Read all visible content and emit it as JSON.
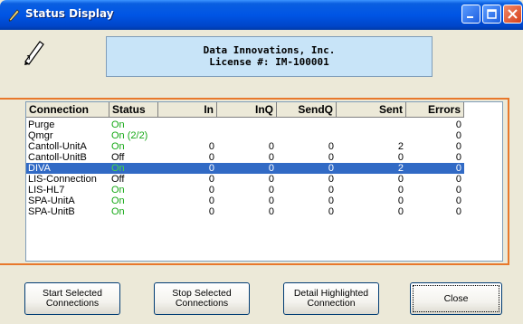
{
  "window": {
    "title": "Status Display"
  },
  "license": {
    "line1": "Data Innovations, Inc.",
    "line2": "License #: IM-100001"
  },
  "table": {
    "columns": [
      "Connection",
      "Status",
      "In",
      "InQ",
      "SendQ",
      "Sent",
      "Errors"
    ],
    "rows": [
      {
        "connection": "Purge",
        "status": "On",
        "in": "",
        "inq": "",
        "sendq": "",
        "sent": "",
        "errors": "0"
      },
      {
        "connection": "Qmgr",
        "status": "On (2/2)",
        "in": "",
        "inq": "",
        "sendq": "",
        "sent": "",
        "errors": "0"
      },
      {
        "connection": "Cantoll-UnitA",
        "status": "On",
        "in": "0",
        "inq": "0",
        "sendq": "0",
        "sent": "2",
        "errors": "0"
      },
      {
        "connection": "Cantoll-UnitB",
        "status": "Off",
        "in": "0",
        "inq": "0",
        "sendq": "0",
        "sent": "0",
        "errors": "0"
      },
      {
        "connection": "DIVA",
        "status": "On",
        "in": "0",
        "inq": "0",
        "sendq": "0",
        "sent": "2",
        "errors": "0"
      },
      {
        "connection": "LIS-Connection",
        "status": "Off",
        "in": "0",
        "inq": "0",
        "sendq": "0",
        "sent": "0",
        "errors": "0"
      },
      {
        "connection": "LIS-HL7",
        "status": "On",
        "in": "0",
        "inq": "0",
        "sendq": "0",
        "sent": "0",
        "errors": "0"
      },
      {
        "connection": "SPA-UnitA",
        "status": "On",
        "in": "0",
        "inq": "0",
        "sendq": "0",
        "sent": "0",
        "errors": "0"
      },
      {
        "connection": "SPA-UnitB",
        "status": "On",
        "in": "0",
        "inq": "0",
        "sendq": "0",
        "sent": "0",
        "errors": "0"
      }
    ],
    "selected_row": "DIVA"
  },
  "buttons": {
    "start": "Start Selected Connections",
    "stop": "Stop Selected Connections",
    "detail": "Detail Highlighted Connection",
    "close": "Close"
  },
  "colors": {
    "title_bar": "#0055e5",
    "selection": "#316ac5",
    "status_on": "#15a815",
    "highlight_frame": "#e8782b",
    "license_bg": "#c8e4f8"
  }
}
